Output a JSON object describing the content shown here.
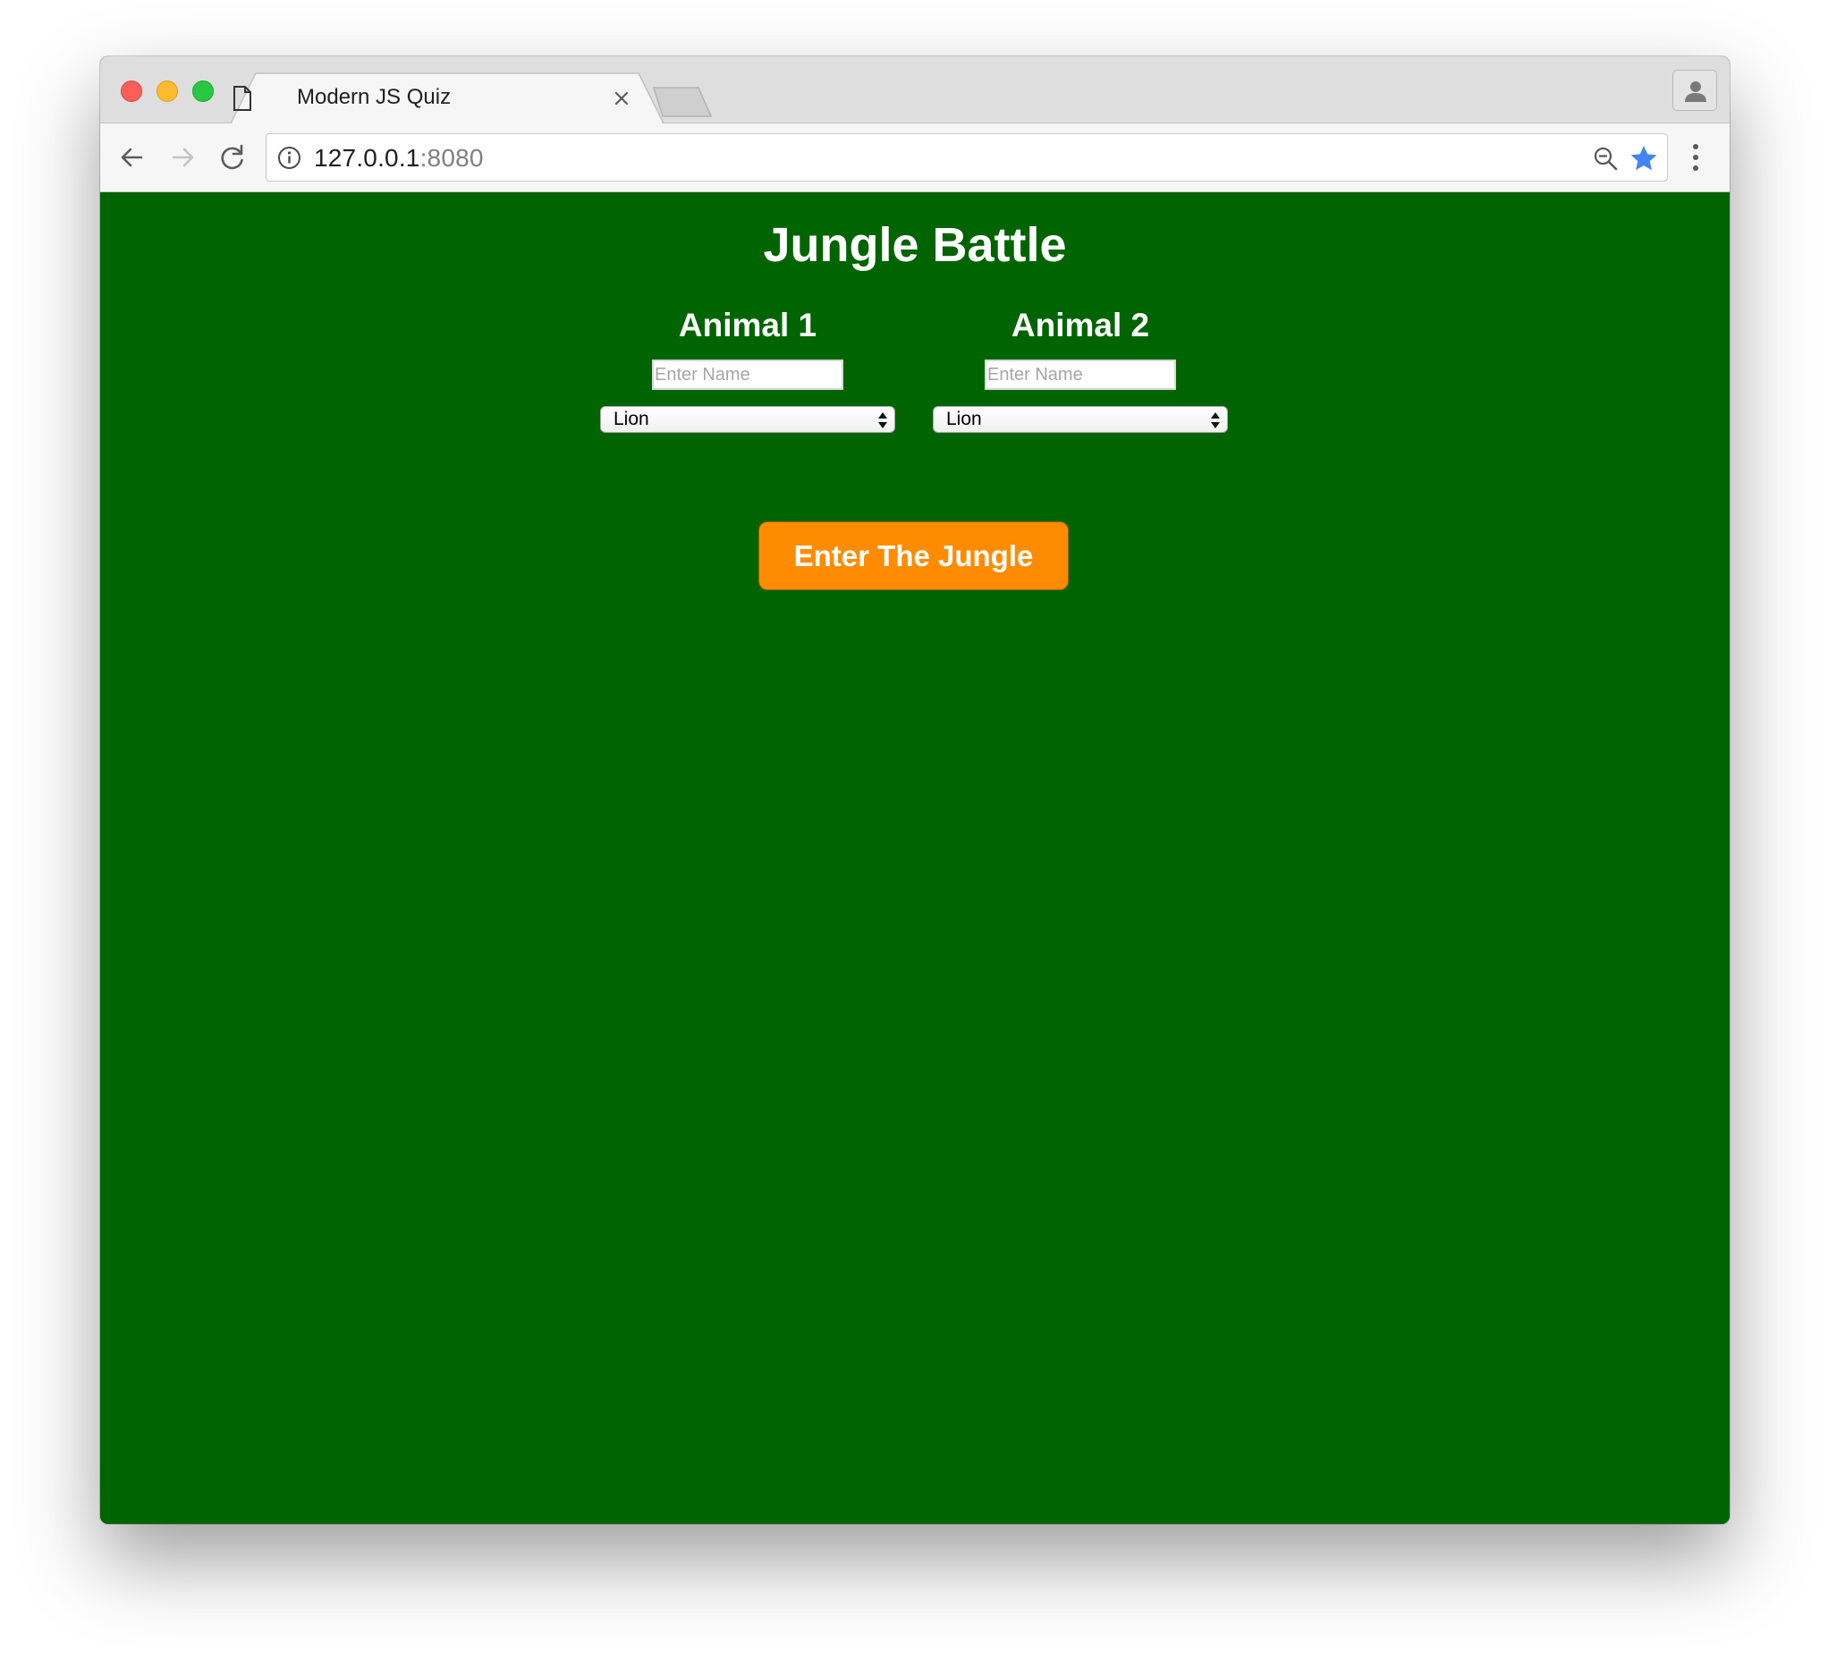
{
  "browser": {
    "tab_title": "Modern JS Quiz",
    "url_host": "127.0.0.1",
    "url_port": ":8080"
  },
  "page": {
    "title": "Jungle Battle",
    "background_color": "#006400",
    "animals": [
      {
        "label": "Animal 1",
        "name_placeholder": "Enter Name",
        "name_value": "",
        "selected_animal": "Lion"
      },
      {
        "label": "Animal 2",
        "name_placeholder": "Enter Name",
        "name_value": "",
        "selected_animal": "Lion"
      }
    ],
    "submit_label": "Enter The Jungle",
    "submit_color": "#ff8c00"
  },
  "icons": {
    "tab": "document-icon",
    "tab_close": "close-icon",
    "back": "back-arrow-icon",
    "forward": "forward-arrow-icon",
    "reload": "reload-icon",
    "site_info": "info-icon",
    "zoom": "zoom-out-icon",
    "bookmark": "star-icon",
    "menu": "kebab-menu-icon",
    "profile": "person-icon"
  }
}
